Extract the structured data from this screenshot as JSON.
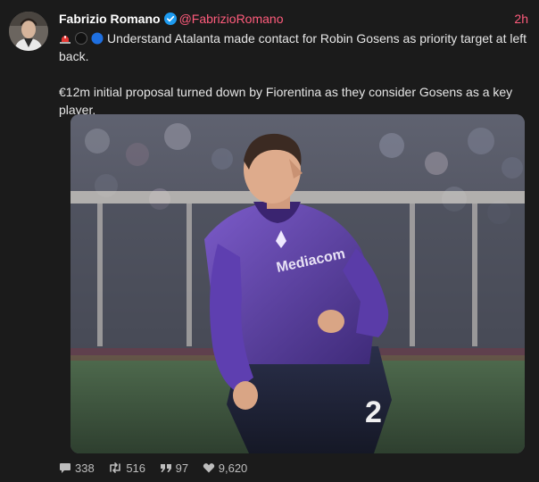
{
  "tweet": {
    "author_name": "Fabrizio Romano",
    "author_handle": "@FabrizioRomano",
    "time_ago": "2h",
    "paragraph_1": "Understand Atalanta made contact for Robin Gosens as priority target at left back.",
    "paragraph_2": "€12m initial proposal turned down by Fiorentina as they consider Gosens as a key player.",
    "emojis": [
      "siren-icon",
      "black-circle-icon",
      "blue-circle-icon"
    ],
    "shirt_sponsor": "Mediacom",
    "shirt_number": "2"
  },
  "stats": {
    "replies": "338",
    "retweets": "516",
    "quotes": "97",
    "likes": "9,620"
  },
  "colors": {
    "background": "#1b1b1b",
    "accent": "#ff5c7c",
    "verified": "#1d9bf0",
    "kit_purple": "#5c3aa3"
  }
}
